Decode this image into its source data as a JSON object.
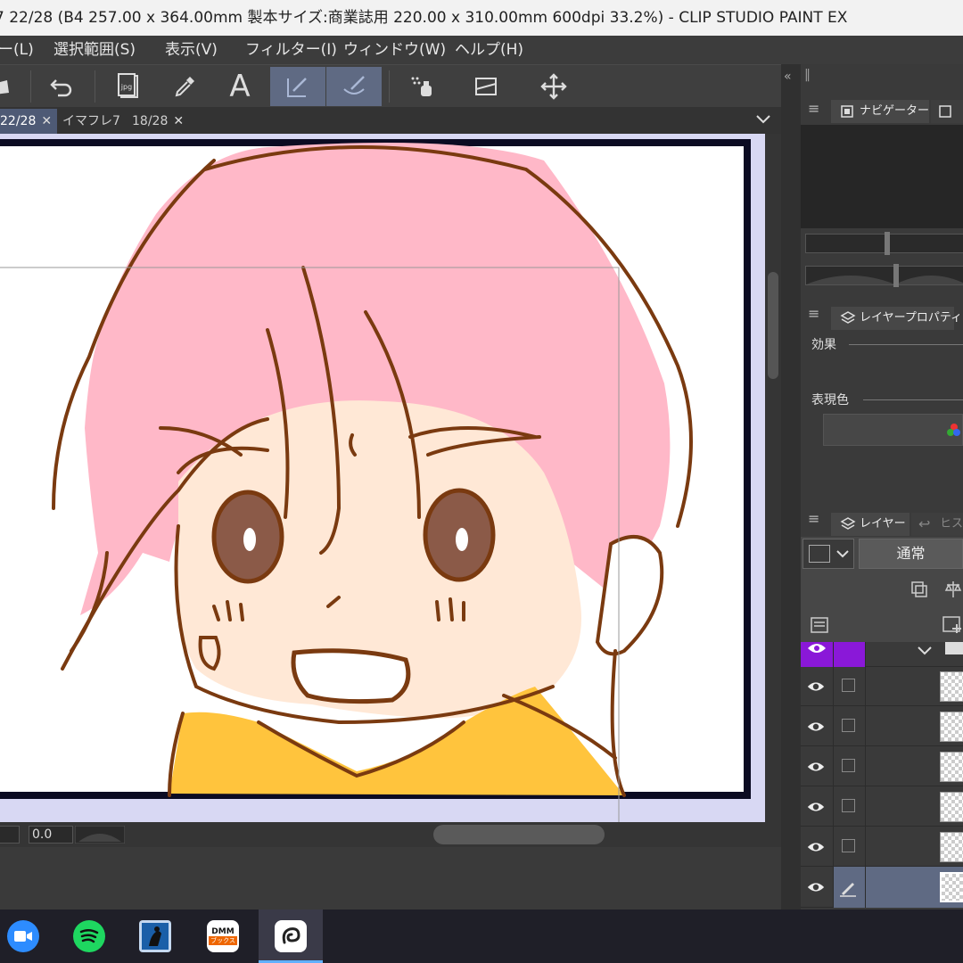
{
  "window": {
    "title": "7 22/28 (B4 257.00 x 364.00mm 製本サイズ:商業誌用 220.00 x 310.00mm 600dpi 33.2%)  - CLIP STUDIO PAINT EX"
  },
  "menu": {
    "items": [
      "ー(L)",
      "選択範囲(S)",
      "表示(V)",
      "フィルター(I)",
      "ウィンドウ(W)",
      "ヘルプ(H)"
    ]
  },
  "toolbar": {
    "buttons": [
      "select-tool-icon",
      "undo-icon",
      "export-jpg-icon",
      "eyedropper-icon",
      "text-tool-icon",
      "pen-tool-icon",
      "brush-tool-icon",
      "fill-tool-icon",
      "ruler-icon",
      "move-icon"
    ],
    "jpg_label": "jpg",
    "text_tool_glyph": "A"
  },
  "tabs": [
    {
      "label": "22/28",
      "active": true,
      "closable": true
    },
    {
      "label": "イマフレ7",
      "active": false,
      "closable": false
    },
    {
      "label": "18/28",
      "active": false,
      "closable": true
    }
  ],
  "status": {
    "zoom_value": "",
    "rotate_value": "0.0"
  },
  "right_panel": {
    "navigator_tab": "ナビゲーター",
    "layer_property_tab": "レイヤープロパティ",
    "effect_label": "効果",
    "expression_color_label": "表現色",
    "layer_tab": "レイヤー",
    "history_tab": "ヒス",
    "blend_mode": "通常",
    "layer_count": 6
  },
  "taskbar": {
    "apps": [
      "zoom-app",
      "spotify-app",
      "kindle-app",
      "dmm-books-app",
      "clip-studio-app"
    ],
    "dmm_top": "DMM",
    "dmm_bottom": "ブックス",
    "active_app": "clip-studio-app"
  },
  "colors": {
    "hair": "#ffb8c8",
    "skin": "#ffe8d6",
    "eyes": "#8b5a48",
    "outline": "#7a3a10",
    "hoodie": "#ffc43d",
    "active_tool": "#5f6a83",
    "layer_highlight": "#8a18d8"
  }
}
